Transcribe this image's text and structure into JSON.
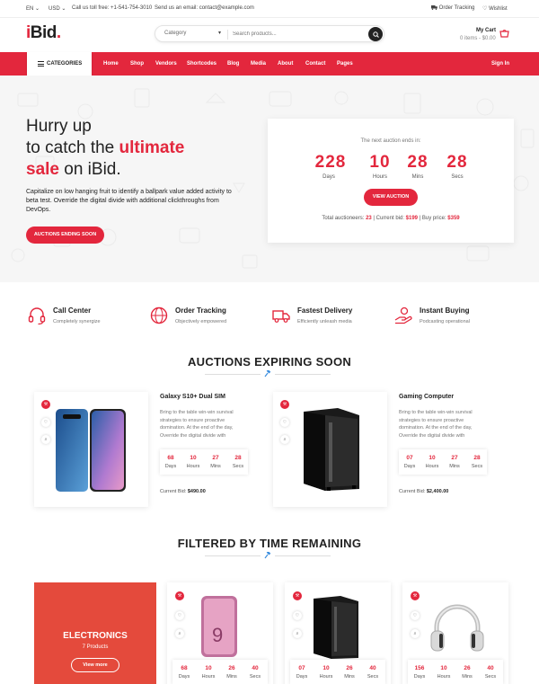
{
  "colors": {
    "brand": "#e3273d",
    "dark": "#222222"
  },
  "topbar": {
    "lang": "EN",
    "currency": "USD",
    "phone": "Call us toll free: +1-541-754-3010",
    "email": "Send us an email: contact@example.com",
    "order_tracking": "Order Tracking",
    "wishlist": "Wishlist"
  },
  "header": {
    "logo_i": "i",
    "logo_rest": "Bid",
    "logo_dot": ".",
    "search": {
      "category": "Category",
      "placeholder": "Search products..."
    },
    "cart": {
      "title": "My Cart",
      "sub": "0 items - $0.00"
    }
  },
  "nav": {
    "categories": "CATEGORIES",
    "items": [
      "Home",
      "Shop",
      "Vendors",
      "Shortcodes",
      "Blog",
      "Media",
      "About",
      "Contact",
      "Pages"
    ],
    "signin": "Sign In"
  },
  "hero": {
    "line1": "Hurry up",
    "line2_pre": "to catch the ",
    "line2_hl": "ultimate",
    "line3_hl": "sale",
    "line3_post": " on iBid.",
    "para": "Capitalize on low hanging fruit to identify a ballpark value added activity to beta test. Override the digital divide with additional clickthroughs from DevOps.",
    "button": "AUCTIONS ENDING SOON"
  },
  "auction": {
    "heading": "The next auction ends in:",
    "countdown": [
      {
        "value": "228",
        "label": "Days"
      },
      {
        "value": "10",
        "label": "Hours"
      },
      {
        "value": "28",
        "label": "Mins"
      },
      {
        "value": "28",
        "label": "Secs"
      }
    ],
    "button": "VIEW AUCTION",
    "footer_pre": "Total auctioneers: ",
    "auctioneers": "23",
    "footer_mid": " | Current bid: ",
    "bid": "$199",
    "footer_mid2": " | Buy price: ",
    "buy": "$359"
  },
  "features": [
    {
      "icon": "headset-icon",
      "title": "Call Center",
      "sub": "Completely synergize"
    },
    {
      "icon": "globe-icon",
      "title": "Order Tracking",
      "sub": "Objectively empowered"
    },
    {
      "icon": "truck-icon",
      "title": "Fastest Delivery",
      "sub": "Efficiently unleash media"
    },
    {
      "icon": "hand-coin-icon",
      "title": "Instant Buying",
      "sub": "Podcasting operational"
    }
  ],
  "section1": {
    "title": "AUCTIONS EXPIRING SOON"
  },
  "products1": [
    {
      "name": "Galaxy S10+ Dual SIM",
      "desc": "Bring to the table win-win survival strategies to ensure proactive domination. At the end of the day, Override the digital divide with",
      "countdown": [
        {
          "value": "68",
          "label": "Days"
        },
        {
          "value": "10",
          "label": "Hours"
        },
        {
          "value": "27",
          "label": "Mins"
        },
        {
          "value": "28",
          "label": "Secs"
        }
      ],
      "bid_label": "Current Bid: ",
      "bid": "$490.00"
    },
    {
      "name": "Gaming Computer",
      "desc": "Bring to the table win-win survival strategies to ensure proactive domination. At the end of the day, Override the digital divide with",
      "countdown": [
        {
          "value": "07",
          "label": "Days"
        },
        {
          "value": "10",
          "label": "Hours"
        },
        {
          "value": "27",
          "label": "Mins"
        },
        {
          "value": "28",
          "label": "Secs"
        }
      ],
      "bid_label": "Current Bid: ",
      "bid": "$2,400.00"
    }
  ],
  "section2": {
    "title": "FILTERED BY TIME REMAINING"
  },
  "electronics": {
    "title": "ELECTRONICS",
    "count": "7 Products",
    "button": "View more"
  },
  "products2": [
    {
      "countdown": [
        {
          "value": "68",
          "label": "Days"
        },
        {
          "value": "10",
          "label": "Hours"
        },
        {
          "value": "26",
          "label": "Mins"
        },
        {
          "value": "40",
          "label": "Secs"
        }
      ]
    },
    {
      "countdown": [
        {
          "value": "07",
          "label": "Days"
        },
        {
          "value": "10",
          "label": "Hours"
        },
        {
          "value": "26",
          "label": "Mins"
        },
        {
          "value": "40",
          "label": "Secs"
        }
      ]
    },
    {
      "countdown": [
        {
          "value": "156",
          "label": "Days"
        },
        {
          "value": "10",
          "label": "Hours"
        },
        {
          "value": "26",
          "label": "Mins"
        },
        {
          "value": "40",
          "label": "Secs"
        }
      ]
    }
  ]
}
